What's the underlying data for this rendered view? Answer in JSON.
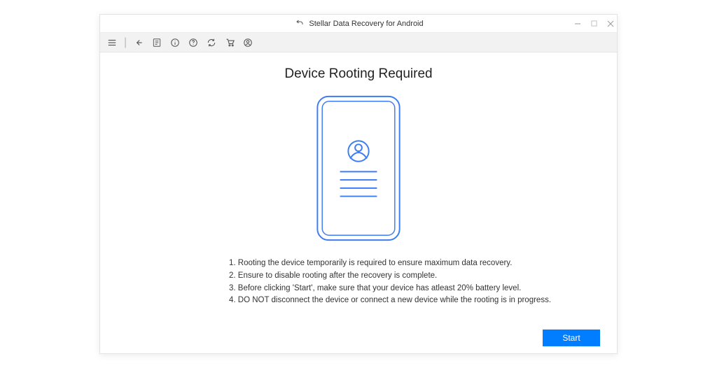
{
  "titlebar": {
    "title": "Stellar Data Recovery for Android"
  },
  "main": {
    "heading": "Device Rooting Required",
    "instructions": [
      "1. Rooting the device temporarily is required to ensure maximum data recovery.",
      "2. Ensure to disable rooting after the recovery is complete.",
      "3. Before clicking 'Start', make sure that your device has atleast 20% battery level.",
      "4. DO NOT disconnect the device or connect a new device while the rooting is in progress."
    ],
    "start_label": "Start"
  }
}
